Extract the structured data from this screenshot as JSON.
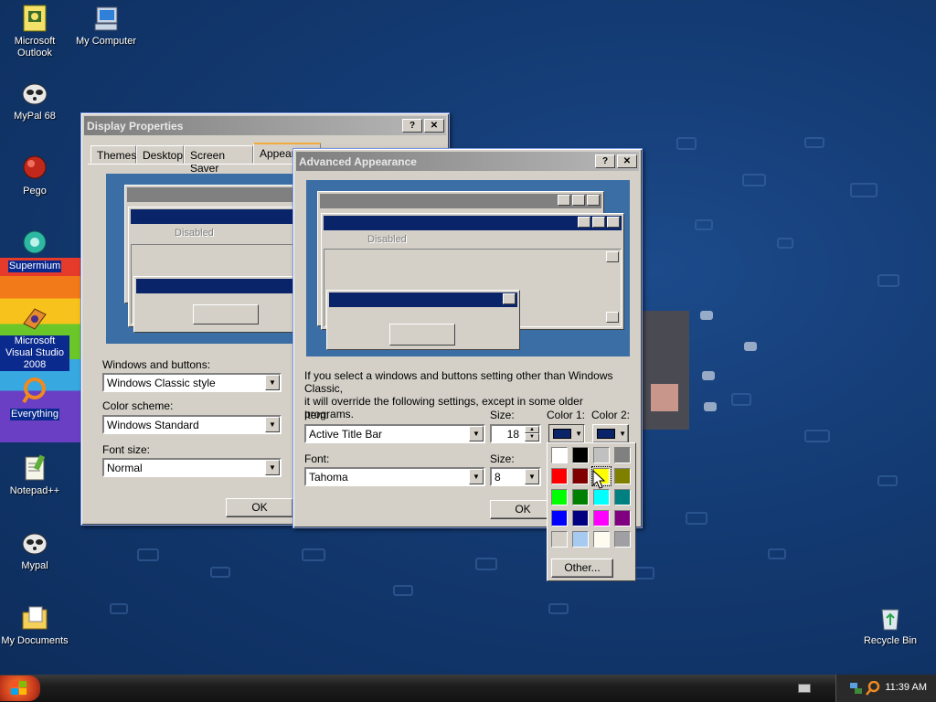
{
  "desktop_icons": [
    {
      "label": "Microsoft Outlook",
      "icon": "outlook-icon"
    },
    {
      "label": "My Computer",
      "icon": "computer-icon"
    },
    {
      "label": "MyPal 68",
      "icon": "mypal-icon"
    },
    {
      "label": "Pego",
      "icon": "pego-icon"
    },
    {
      "label": "Supermium",
      "icon": "supermium-icon"
    },
    {
      "label": "Microsoft Visual Studio 2008",
      "icon": "visual-studio-icon"
    },
    {
      "label": "Everything",
      "icon": "everything-icon"
    },
    {
      "label": "Notepad++",
      "icon": "notepadpp-icon"
    },
    {
      "label": "Mypal",
      "icon": "mypal-icon"
    },
    {
      "label": "My Documents",
      "icon": "documents-icon"
    },
    {
      "label": "Recycle Bin",
      "icon": "recycle-bin-icon"
    }
  ],
  "display_properties": {
    "title": "Display Properties",
    "tabs": [
      "Themes",
      "Desktop",
      "Screen Saver",
      "Appearance"
    ],
    "preview_disabled": "Disabled",
    "windows_buttons_label": "Windows and buttons:",
    "windows_buttons_value": "Windows Classic style",
    "color_scheme_label": "Color scheme:",
    "color_scheme_value": "Windows Standard",
    "font_size_label": "Font size:",
    "font_size_value": "Normal",
    "ok": "OK"
  },
  "advanced_appearance": {
    "title": "Advanced Appearance",
    "preview_disabled": "Disabled",
    "note_line1": "If you select a windows and buttons setting other than Windows Classic,",
    "note_line2": "it will override the following settings, except in some older programs.",
    "item_label": "Item:",
    "item_value": "Active Title Bar",
    "size_label": "Size:",
    "size_value": "18",
    "color1_label": "Color 1:",
    "color2_label": "Color 2:",
    "color1": "#0a246a",
    "color2": "#0a246a",
    "font_label": "Font:",
    "font_value": "Tahoma",
    "font_size_label": "Size:",
    "font_size_value": "8",
    "ok": "OK"
  },
  "palette": {
    "colors": [
      "#ffffff",
      "#000000",
      "#c0c0c0",
      "#808080",
      "#ff0000",
      "#800000",
      "#ffff00",
      "#808000",
      "#00ff00",
      "#008000",
      "#00ffff",
      "#008080",
      "#0000ff",
      "#000080",
      "#ff00ff",
      "#800080",
      "#d4d0c8",
      "#a6caf0",
      "#fffbf0",
      "#a0a0a4"
    ],
    "other_label": "Other..."
  },
  "taskbar": {
    "clock": "11:39 AM"
  }
}
